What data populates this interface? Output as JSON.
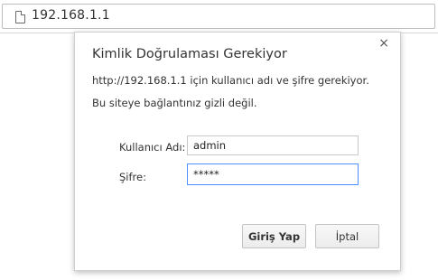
{
  "browser": {
    "url": "192.168.1.1",
    "page_icon": "page-icon"
  },
  "dialog": {
    "title": "Kimlik Doğrulaması Gerekiyor",
    "close_icon": "×",
    "message_1": "http://192.168.1.1 için kullanıcı adı ve şifre gerekiyor.",
    "message_2": "Bu siteye bağlantınız gizli değil.",
    "username_label": "Kullanıcı Adı:",
    "username_value": "admin",
    "password_label": "Şifre:",
    "password_value": "*****",
    "login_button": "Giriş Yap",
    "cancel_button": "İptal",
    "focus_color": "#4d90fe"
  }
}
